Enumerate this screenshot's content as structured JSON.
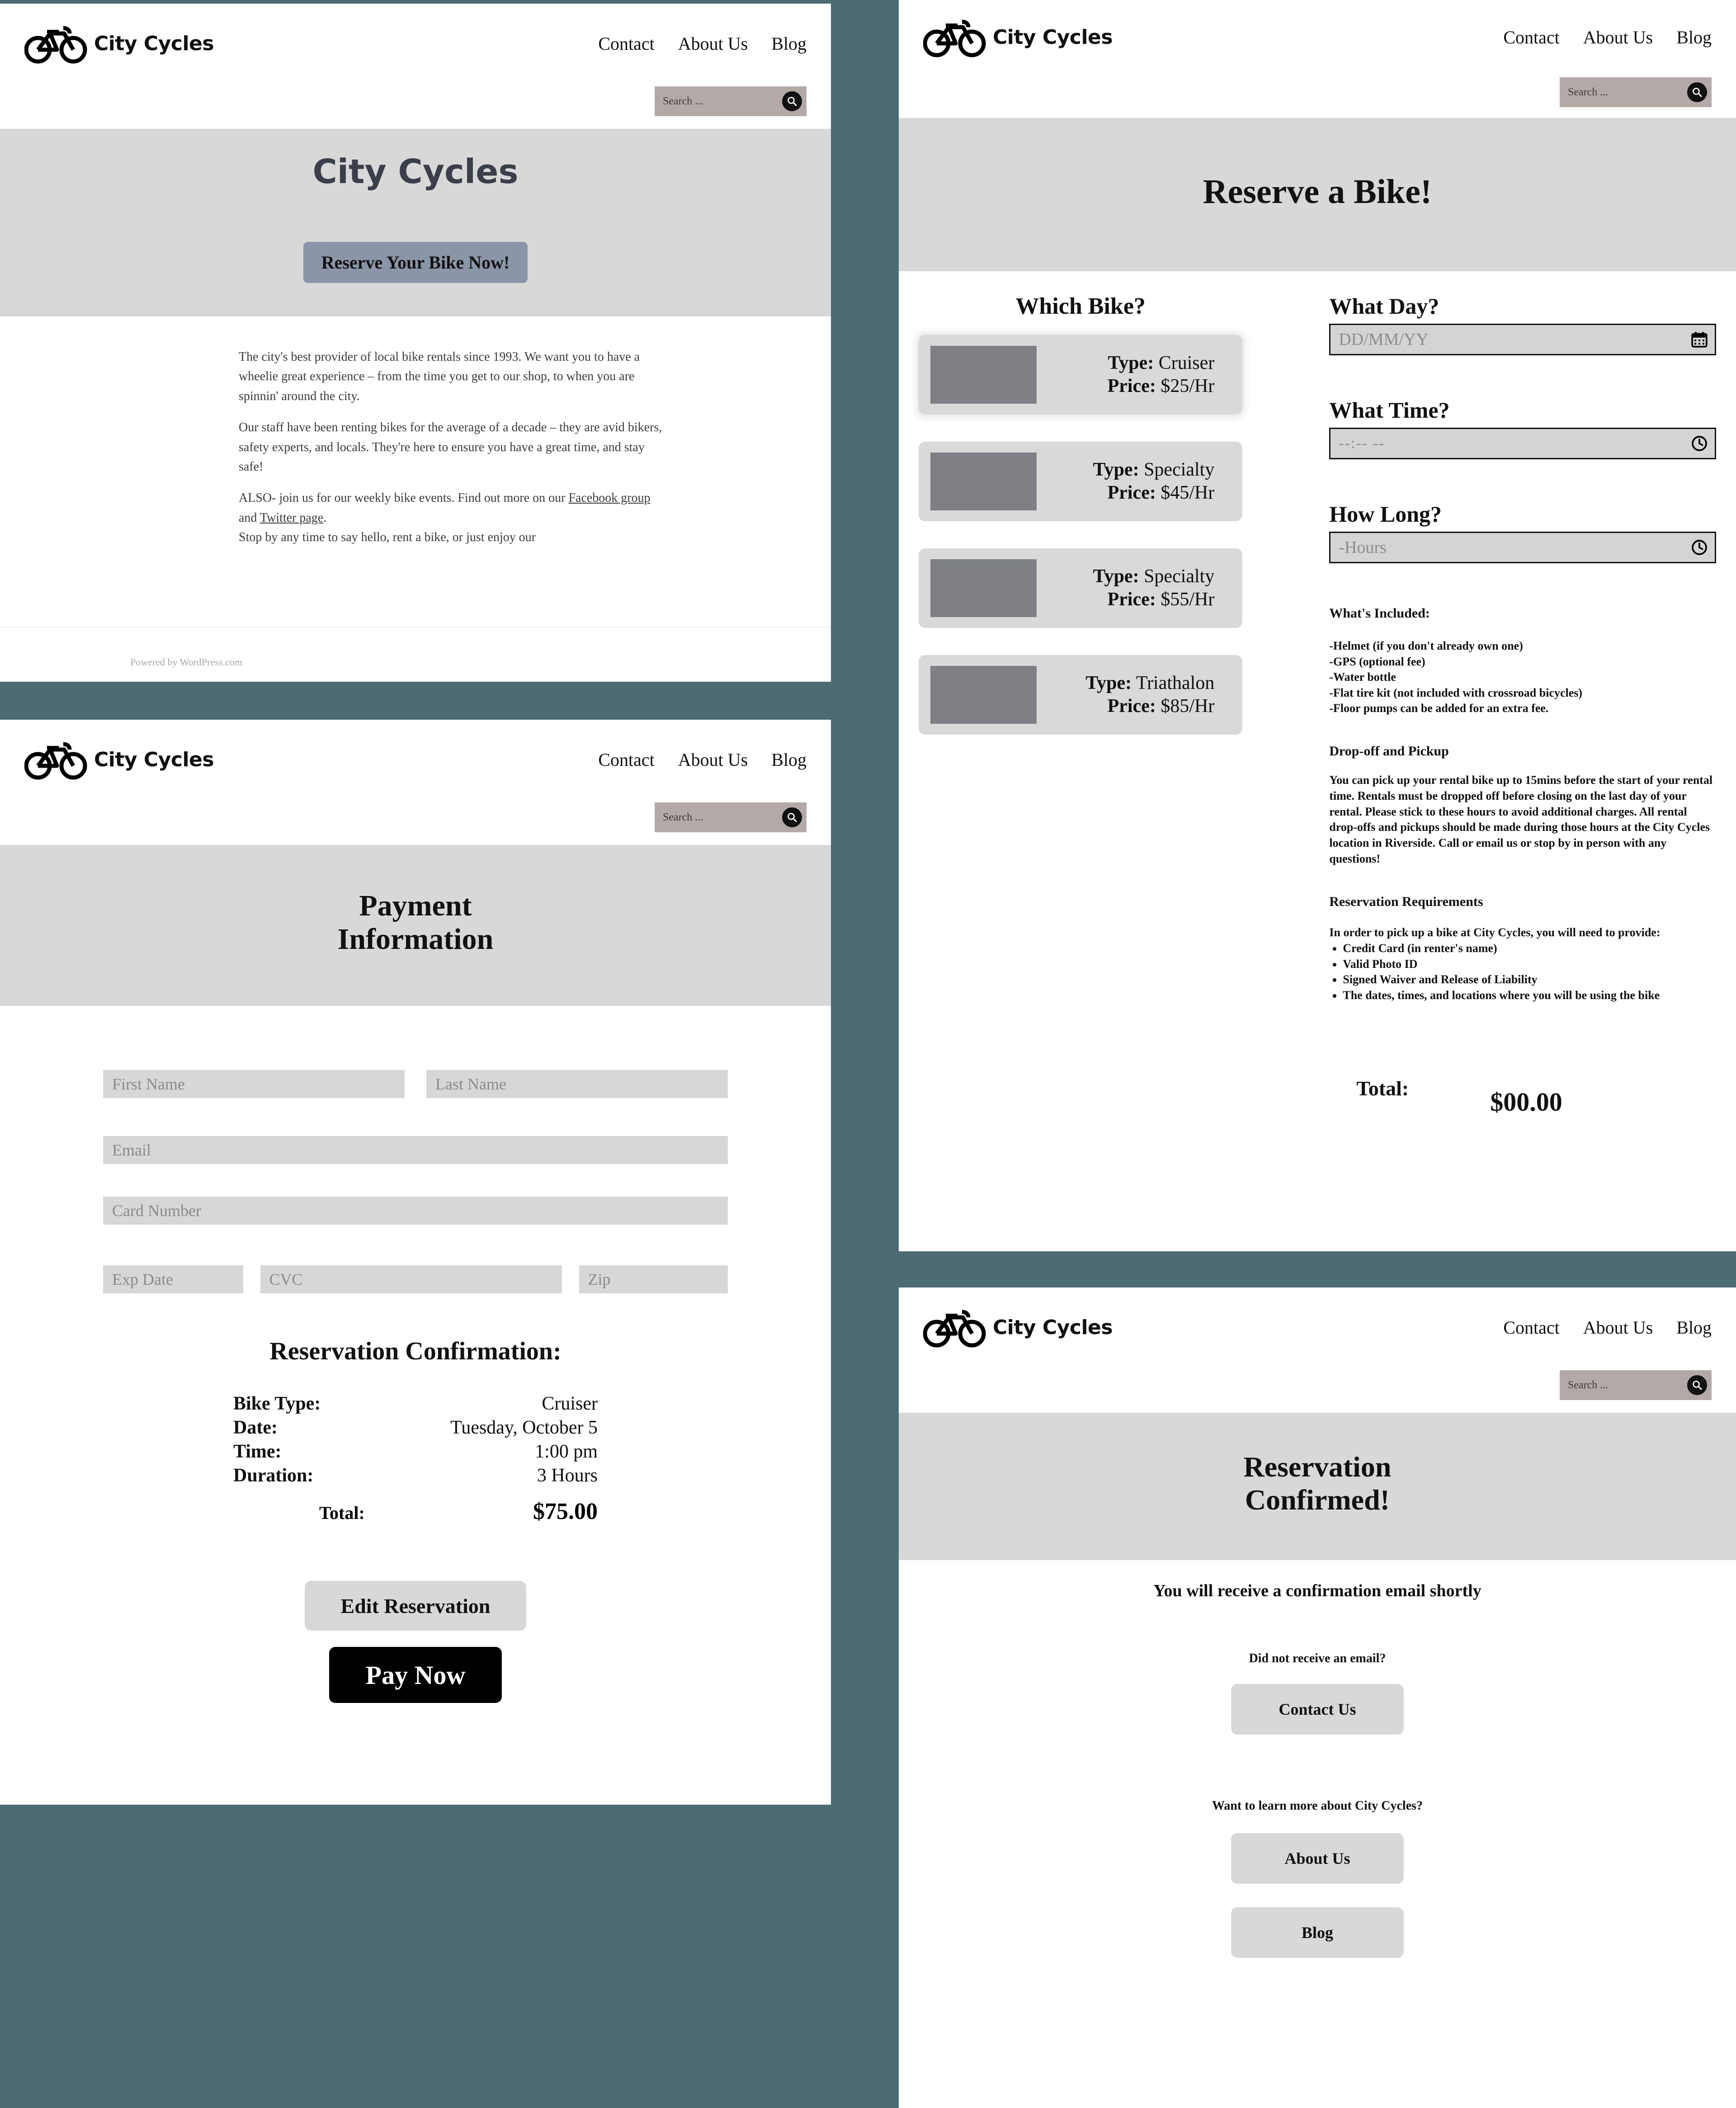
{
  "brand": {
    "name": "City Cycles",
    "logo_icon": "bicycle-icon"
  },
  "nav": {
    "items": [
      "Contact",
      "About Us",
      "Blog"
    ]
  },
  "search": {
    "placeholder": "Search ...",
    "icon": "search-icon"
  },
  "home": {
    "hero_title": "City Cycles",
    "cta_label": "Reserve Your Bike Now!",
    "paragraphs": [
      "The city's best provider of local bike rentals since 1993. We want you to have a wheelie great experience – from the time you get to our shop, to when you are spinnin' around the city.",
      "Our staff have been renting bikes for the average of a decade – they are avid bikers, safety experts, and locals. They're here to ensure you have a great time, and stay safe!"
    ],
    "final_paragraph_pre": "ALSO- join us for our weekly bike events. Find out more on our ",
    "link_facebook": "Facebook group",
    "final_paragraph_mid": " and ",
    "link_twitter": "Twitter page",
    "final_paragraph_post": ".",
    "final_line": "Stop by any time to say hello, rent a bike, or just enjoy our",
    "footer_credit": "Powered by WordPress.com"
  },
  "reserve": {
    "hero_title": "Reserve a Bike!",
    "which_bike_heading": "Which Bike?",
    "bikes": [
      {
        "type_label": "Type:",
        "type": "Cruiser",
        "price_label": "Price:",
        "price": "$25/Hr",
        "selected": true,
        "thumb": "bike-photo-placeholder"
      },
      {
        "type_label": "Type:",
        "type": "Specialty",
        "price_label": "Price:",
        "price": "$45/Hr",
        "selected": false,
        "thumb": "bike-photo-placeholder"
      },
      {
        "type_label": "Type:",
        "type": "Specialty",
        "price_label": "Price:",
        "price": "$55/Hr",
        "selected": false,
        "thumb": "bike-photo-placeholder"
      },
      {
        "type_label": "Type:",
        "type": "Triathalon",
        "price_label": "Price:",
        "price": "$85/Hr",
        "selected": false,
        "thumb": "bike-photo-placeholder"
      }
    ],
    "fields": [
      {
        "label": "What Day?",
        "placeholder": "DD/MM/YY",
        "icon": "calendar-icon"
      },
      {
        "label": "What Time?",
        "placeholder": "--:-- --",
        "icon": "clock-icon"
      },
      {
        "label": "How Long?",
        "placeholder": "-Hours",
        "icon": "clock-icon"
      }
    ],
    "included_heading": "What's Included:",
    "included_lines": [
      "-Helmet (if you don't already own one)",
      "-GPS (optional fee)",
      "-Water bottle",
      "-Flat tire kit (not included with crossroad bicycles)",
      "-Floor pumps can be added for an extra fee."
    ],
    "dropoff_heading": "Drop-off and Pickup",
    "dropoff_body": "You can pick up your rental bike up to 15mins before the start of your rental time. Rentals must be dropped off before closing on the last day of your rental. Please stick to these hours to avoid additional charges. All rental drop-offs and pickups should be made during those hours at the City Cycles location in Riverside. Call or email us or stop by in person with any questions!",
    "requirements_heading": "Reservation Requirements",
    "requirements_intro": "In order to pick up a bike at City Cycles, you will need to provide:",
    "requirements_items": [
      "Credit Card (in renter's name)",
      "Valid Photo ID",
      "Signed Waiver and Release of Liability",
      "The dates, times, and locations where you will be using the bike"
    ],
    "total_label": "Total:",
    "total_value": "$00.00"
  },
  "payment": {
    "hero_title_line1": "Payment",
    "hero_title_line2": "Information",
    "fields": {
      "first_name": "First Name",
      "last_name": "Last Name",
      "email": "Email",
      "card_number": "Card Number",
      "exp_date": "Exp Date",
      "cvc": "CVC",
      "zip": "Zip"
    },
    "confirmation_title": "Reservation Confirmation:",
    "confirmation_rows": [
      {
        "label": "Bike Type:",
        "value": "Cruiser"
      },
      {
        "label": "Date:",
        "value": "Tuesday, October 5"
      },
      {
        "label": "Time:",
        "value": "1:00 pm"
      },
      {
        "label": "Duration:",
        "value": "3 Hours"
      }
    ],
    "total_label": "Total:",
    "total_value": "$75.00",
    "edit_button": "Edit Reservation",
    "pay_button": "Pay Now"
  },
  "confirmed": {
    "hero_title_line1": "Reservation",
    "hero_title_line2": "Confirmed!",
    "email_notice": "You will receive a confirmation email shortly",
    "no_email_prompt": "Did not receive an email?",
    "contact_button": "Contact Us",
    "learn_more_prompt": "Want to learn more about City Cycles?",
    "about_button": "About Us",
    "blog_button": "Blog"
  },
  "colors": {
    "page_background": "#4c6b73",
    "hero_band": "#d8d8d8",
    "cta": "#8a96a8",
    "search_field": "#b3aaa8",
    "card": "#d9d9d9",
    "thumb": "#7e8085"
  }
}
